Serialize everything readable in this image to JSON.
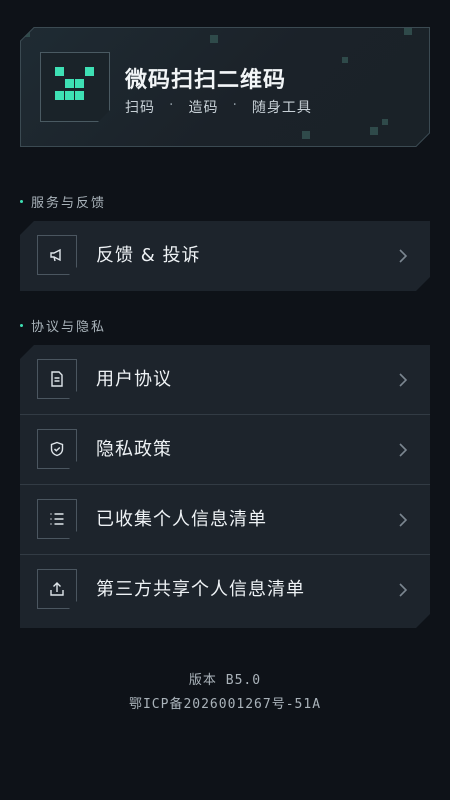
{
  "hero": {
    "title": "微码扫扫二维码",
    "sub": [
      "扫码",
      "造码",
      "随身工具"
    ],
    "sep": "·"
  },
  "sections": {
    "feedback": {
      "label": "服务与反馈",
      "items": [
        {
          "label": "反馈 & 投诉",
          "icon": "megaphone-icon"
        }
      ]
    },
    "privacy": {
      "label": "协议与隐私",
      "items": [
        {
          "label": "用户协议",
          "icon": "document-icon"
        },
        {
          "label": "隐私政策",
          "icon": "shield-icon"
        },
        {
          "label": "已收集个人信息清单",
          "icon": "list-icon"
        },
        {
          "label": "第三方共享个人信息清单",
          "icon": "share-upload-icon"
        }
      ]
    }
  },
  "footer": {
    "version": "版本 B5.0",
    "icp": "鄂ICP备2026001267号-51A"
  },
  "colors": {
    "accent": "#3ee0b4",
    "background": "#0e1218",
    "card": "#1d242c"
  }
}
